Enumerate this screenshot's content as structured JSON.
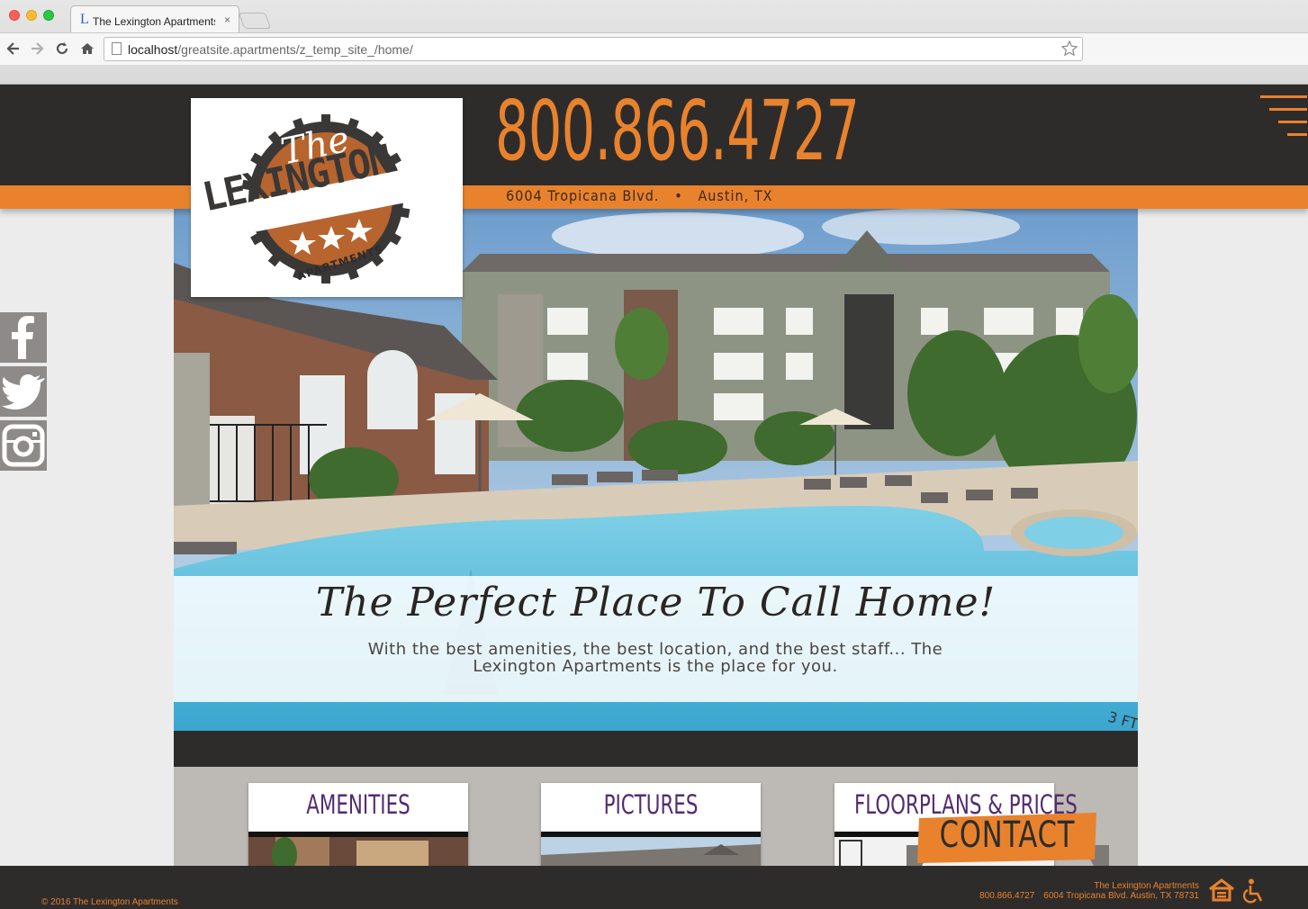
{
  "browser": {
    "tab_title": "The Lexington Apartments",
    "tab_favicon": "L",
    "tab_close": "×",
    "url_host": "localhost",
    "url_path": "/greatsite.apartments/z_temp_site_/home/",
    "icons": [
      "back-arrow-icon",
      "forward-arrow-icon",
      "reload-icon",
      "home-icon",
      "page-icon",
      "bookmark-star-icon"
    ]
  },
  "header": {
    "phone": "800.866.4727",
    "address_street": "6004 Tropicana Blvd.",
    "address_sep": "•",
    "address_city": "Austin, TX",
    "menu_icon": "hamburger-menu-icon"
  },
  "logo": {
    "line1": "The",
    "line2": "LEXINGTON",
    "line3": "APARTMENTS"
  },
  "social": [
    "facebook-icon",
    "twitter-icon",
    "instagram-icon"
  ],
  "hero": {
    "tagline": "The Perfect Place To Call Home!",
    "subline": "With the best amenities, the best location, and the best staff... The Lexington Apartments is the place for you."
  },
  "cards": [
    {
      "label": "AMENITIES"
    },
    {
      "label": "PICTURES"
    },
    {
      "label": "FLOORPLANS & PRICES"
    }
  ],
  "contact": {
    "label": "CONTACT"
  },
  "footer": {
    "copyright": "© 2016 The Lexington Apartments",
    "name": "The Lexington Apartments",
    "phone": "800.866.4727",
    "address": "6004 Tropicana Blvd. Austin, TX 78731"
  },
  "colors": {
    "orange": "#e9822d",
    "charcoal": "#2e2c2b",
    "purple": "#532c72"
  }
}
